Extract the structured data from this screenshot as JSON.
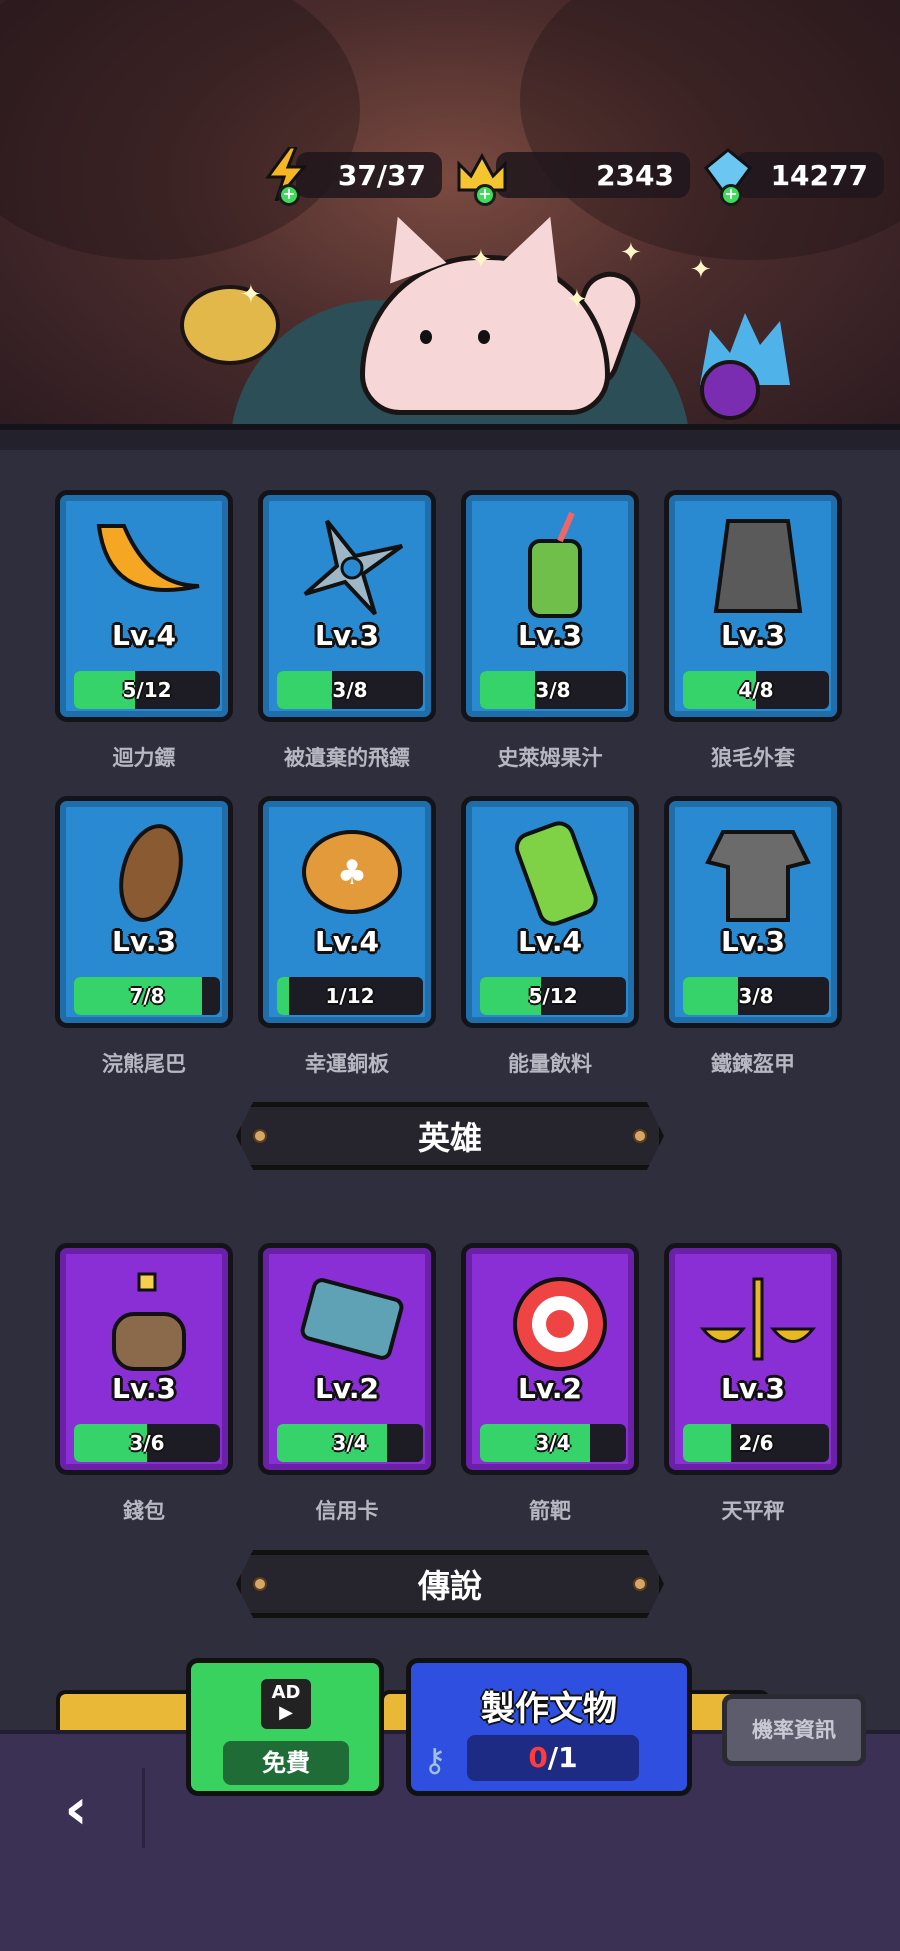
{
  "resources": {
    "energy": {
      "value": "37/37",
      "icon": "lightning-icon"
    },
    "crowns": {
      "value": "2343",
      "icon": "crown-icon"
    },
    "gems": {
      "value": "14277",
      "icon": "gem-icon"
    }
  },
  "items": [
    {
      "name": "迴力鏢",
      "level": "Lv.4",
      "progress": "5/12",
      "fill": 0.42,
      "icon": "boomerang-icon"
    },
    {
      "name": "被遺棄的飛鏢",
      "level": "Lv.3",
      "progress": "3/8",
      "fill": 0.375,
      "icon": "shuriken-icon"
    },
    {
      "name": "史萊姆果汁",
      "level": "Lv.3",
      "progress": "3/8",
      "fill": 0.375,
      "icon": "slime-juice-icon"
    },
    {
      "name": "狼毛外套",
      "level": "Lv.3",
      "progress": "4/8",
      "fill": 0.5,
      "icon": "wolf-coat-icon"
    },
    {
      "name": "浣熊尾巴",
      "level": "Lv.3",
      "progress": "7/8",
      "fill": 0.875,
      "icon": "raccoon-tail-icon"
    },
    {
      "name": "幸運銅板",
      "level": "Lv.4",
      "progress": "1/12",
      "fill": 0.08,
      "icon": "lucky-coin-icon"
    },
    {
      "name": "能量飲料",
      "level": "Lv.4",
      "progress": "5/12",
      "fill": 0.42,
      "icon": "energy-drink-icon"
    },
    {
      "name": "鐵鍊盔甲",
      "level": "Lv.3",
      "progress": "3/8",
      "fill": 0.375,
      "icon": "chainmail-icon"
    }
  ],
  "hero_section": {
    "title": "英雄"
  },
  "hero_items": [
    {
      "name": "錢包",
      "level": "Lv.3",
      "progress": "3/6",
      "fill": 0.5,
      "icon": "wallet-icon"
    },
    {
      "name": "信用卡",
      "level": "Lv.2",
      "progress": "3/4",
      "fill": 0.75,
      "icon": "credit-card-icon"
    },
    {
      "name": "箭靶",
      "level": "Lv.2",
      "progress": "3/4",
      "fill": 0.75,
      "icon": "target-icon"
    },
    {
      "name": "天平秤",
      "level": "Lv.3",
      "progress": "2/6",
      "fill": 0.33,
      "icon": "scale-icon"
    }
  ],
  "legend_section": {
    "title": "傳說"
  },
  "bottom": {
    "free_button": {
      "ad_label": "AD",
      "label": "免費"
    },
    "craft_button": {
      "title": "製作文物",
      "count_current": "0",
      "count_total": "/1"
    },
    "rate_info": "機率資訊"
  },
  "colors": {
    "card_blue": "#2a8ad1",
    "card_purple": "#8a2fd6",
    "progress_green": "#36d36a",
    "accent_red": "#ff3b3b"
  }
}
